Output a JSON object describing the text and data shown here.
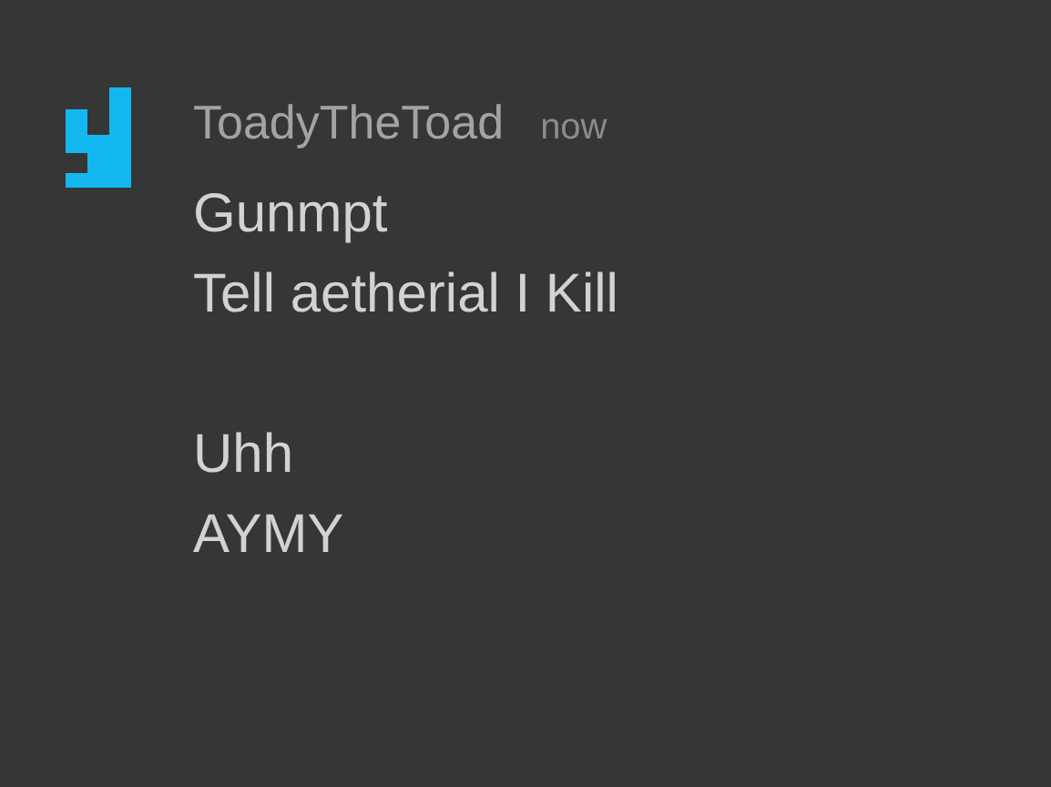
{
  "message": {
    "author": "ToadyTheToad",
    "time": "now",
    "paragraphs": [
      {
        "lines": [
          "Gunmpt",
          "Tell aetherial I Kill"
        ]
      },
      {
        "lines": [
          "Uhh",
          "AYMY"
        ]
      }
    ]
  }
}
